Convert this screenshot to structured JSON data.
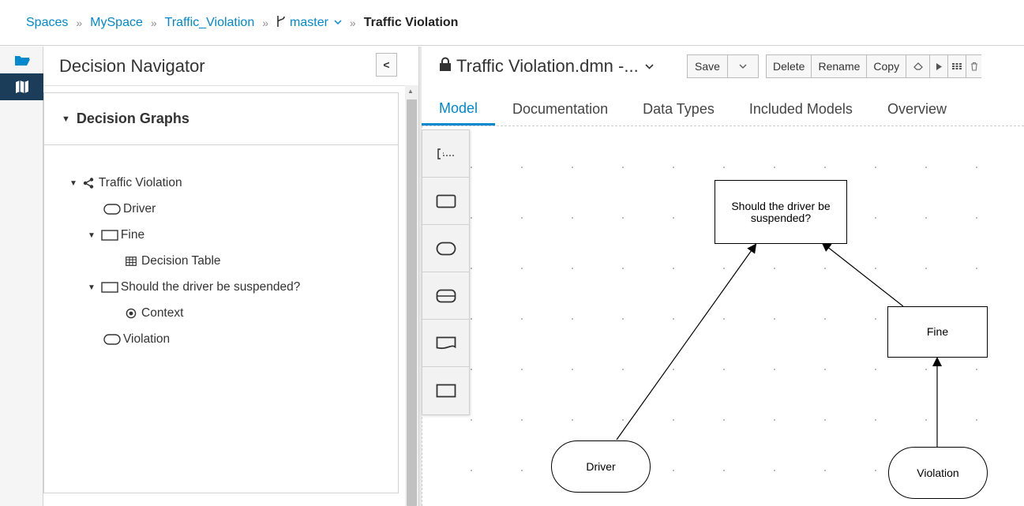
{
  "breadcrumb": {
    "spaces": "Spaces",
    "space": "MySpace",
    "project": "Traffic_Violation",
    "branch": "master",
    "current": "Traffic Violation",
    "separator": "»"
  },
  "rail": {
    "icons": [
      "folder-icon",
      "map-icon"
    ]
  },
  "navigator": {
    "title": "Decision Navigator",
    "collapse_label": "<",
    "section_title": "Decision Graphs",
    "tree": {
      "root": "Traffic Violation",
      "driver": "Driver",
      "fine": "Fine",
      "decision_table": "Decision Table",
      "suspended": "Should the driver be suspended?",
      "context": "Context",
      "violation": "Violation"
    }
  },
  "editor": {
    "file_title": "Traffic Violation.dmn -...",
    "toolbar": {
      "save": "Save",
      "delete": "Delete",
      "rename": "Rename",
      "copy": "Copy"
    },
    "tabs": [
      "Model",
      "Documentation",
      "Data Types",
      "Included Models",
      "Overview"
    ],
    "active_tab": "Model"
  },
  "diagram": {
    "nodes": {
      "suspended": "Should the driver be suspended?",
      "fine": "Fine",
      "driver": "Driver",
      "violation": "Violation"
    }
  },
  "colors": {
    "accent": "#0088ce",
    "rail_active": "#1c3d5a",
    "text": "#333333"
  }
}
